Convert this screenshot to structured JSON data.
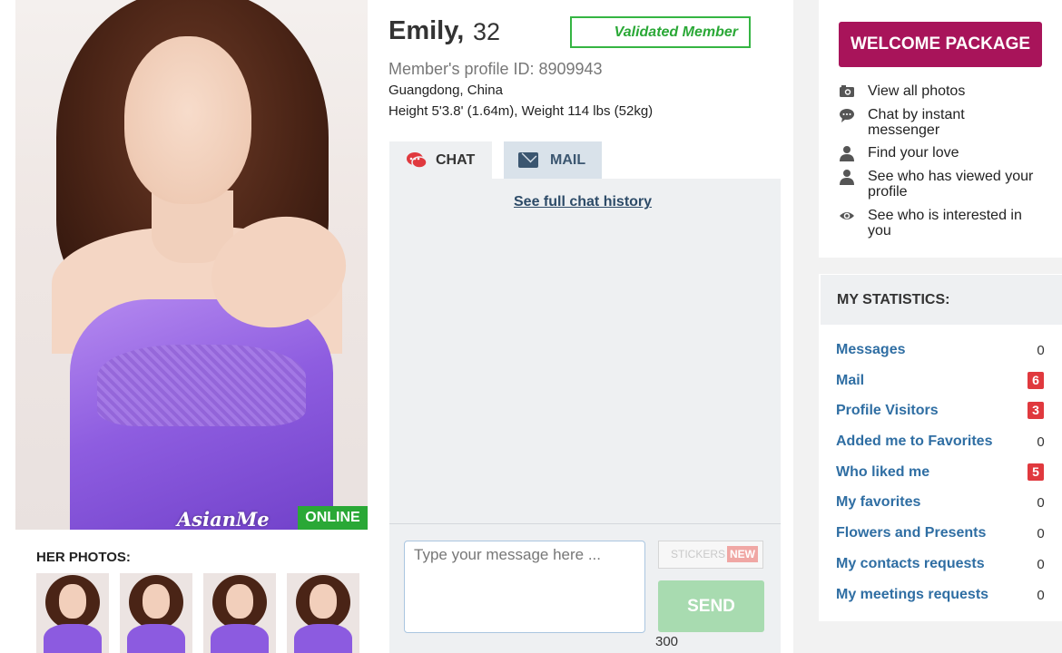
{
  "profile": {
    "name": "Emily,",
    "age": "32",
    "validated": "Validated Member",
    "profile_id": "Member's profile ID: 8909943",
    "location": "Guangdong, China",
    "height_weight": "Height 5'3.8' (1.64m), Weight 114 lbs (52kg)",
    "online_label": "ONLINE",
    "watermark": "AsianMe",
    "photos_heading": "HER PHOTOS:"
  },
  "tabs": [
    {
      "label": "CHAT",
      "icon": "chat-bubble-icon",
      "active": true
    },
    {
      "label": "MAIL",
      "icon": "envelope-icon",
      "active": false
    }
  ],
  "chat": {
    "history_link": "See full chat history",
    "placeholder": "Type your message here ...",
    "stickers_label": "STICKERS",
    "new_badge": "NEW",
    "send_label": "SEND",
    "char_counter": "300"
  },
  "welcome": {
    "button_label": "WELCOME PACKAGE",
    "features": [
      {
        "icon": "camera-icon",
        "label": "View all photos"
      },
      {
        "icon": "chat-bubble-icon",
        "label": "Chat by instant messenger"
      },
      {
        "icon": "user-icon",
        "label": "Find your love"
      },
      {
        "icon": "user-icon",
        "label": "See who has viewed your profile"
      },
      {
        "icon": "eye-icon",
        "label": "See who is interested in you"
      }
    ]
  },
  "stats": {
    "heading": "MY STATISTICS:",
    "items": [
      {
        "label": "Messages",
        "value": "0",
        "badge": false
      },
      {
        "label": "Mail",
        "value": "6",
        "badge": true
      },
      {
        "label": "Profile Visitors",
        "value": "3",
        "badge": true
      },
      {
        "label": "Added me to Favorites",
        "value": "0",
        "badge": false
      },
      {
        "label": "Who liked me",
        "value": "5",
        "badge": true
      },
      {
        "label": "My favorites",
        "value": "0",
        "badge": false
      },
      {
        "label": "Flowers and Presents",
        "value": "0",
        "badge": false
      },
      {
        "label": "My contacts requests",
        "value": "0",
        "badge": false
      },
      {
        "label": "My meetings requests",
        "value": "0",
        "badge": false
      }
    ]
  },
  "colors": {
    "accent": "#a8145a",
    "online_green": "#2aa836",
    "link_blue": "#2f6ea3",
    "badge_red": "#e0393e",
    "send_green": "#a8dbb0"
  }
}
